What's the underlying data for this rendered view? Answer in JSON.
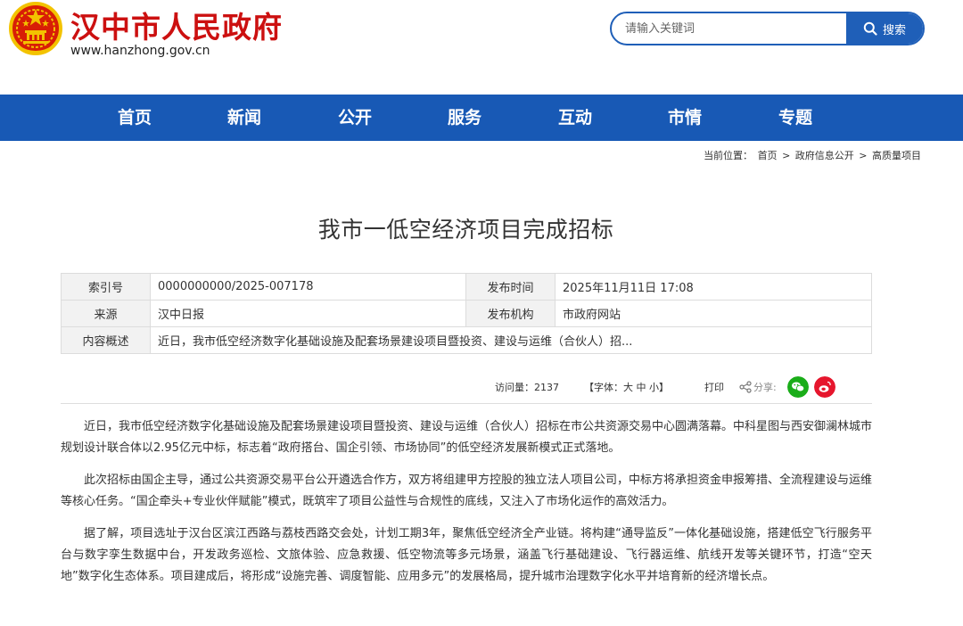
{
  "header": {
    "site_title": "汉中市人民政府",
    "site_url": "www.hanzhong.gov.cn",
    "emblem_icon": "national-emblem-icon"
  },
  "search": {
    "placeholder": "请输入关键词",
    "button_label": "搜索",
    "icon": "search-icon"
  },
  "nav": {
    "items": [
      {
        "label": "首页"
      },
      {
        "label": "新闻"
      },
      {
        "label": "公开"
      },
      {
        "label": "服务"
      },
      {
        "label": "互动"
      },
      {
        "label": "市情"
      },
      {
        "label": "专题"
      }
    ]
  },
  "breadcrumb": {
    "prefix": "当前位置：",
    "items": [
      "首页",
      "政府信息公开",
      "高质量项目"
    ],
    "separator": ">"
  },
  "article": {
    "title": "我市一低空经济项目完成招标",
    "meta": {
      "index_label": "索引号",
      "index_value": "0000000000/2025-007178",
      "publish_time_label": "发布时间",
      "publish_time_value": "2025年11月11日 17:08",
      "source_label": "来源",
      "source_value": "汉中日报",
      "publisher_label": "发布机构",
      "publisher_value": "市政府网站",
      "summary_label": "内容概述",
      "summary_value": "近日，我市低空经济数字化基础设施及配套场景建设项目暨投资、建设与运维（合伙人）招..."
    },
    "tools": {
      "views_label": "访问量：",
      "views_value": "2137",
      "font_prefix": "【字体：",
      "font_large": "大",
      "font_medium": "中",
      "font_small": "小",
      "font_suffix": "】",
      "print_label": "打印",
      "share_label": "分享:",
      "share_icon": "share-icon",
      "wechat_icon": "wechat-icon",
      "weibo_icon": "weibo-icon"
    },
    "paragraphs": [
      "近日，我市低空经济数字化基础设施及配套场景建设项目暨投资、建设与运维（合伙人）招标在市公共资源交易中心圆满落幕。中科星图与西安御澜林城市规划设计联合体以2.95亿元中标，标志着“政府搭台、国企引领、市场协同”的低空经济发展新模式正式落地。",
      "此次招标由国企主导，通过公共资源交易平台公开遴选合作方，双方将组建甲方控股的独立法人项目公司，中标方将承担资金申报筹措、全流程建设与运维等核心任务。“国企牵头+专业伙伴赋能”模式，既筑牢了项目公益性与合规性的底线，又注入了市场化运作的高效活力。",
      "据了解，项目选址于汉台区滨江西路与荔枝西路交会处，计划工期3年，聚焦低空经济全产业链。将构建“通导监反”一体化基础设施，搭建低空飞行服务平台与数字孪生数据中台，开发政务巡检、文旅体验、应急救援、低空物流等多元场景，涵盖飞行基础建设、飞行器运维、航线开发等关键环节，打造“空天地”数字化生态体系。项目建成后，将形成“设施完善、调度智能、应用多元”的发展格局，提升城市治理数字化水平并培育新的经济增长点。"
    ]
  },
  "colors": {
    "brand_red": "#cc1010",
    "nav_blue": "#1859b5",
    "search_blue": "#1f5fb8",
    "wechat_green": "#1aad19",
    "weibo_red": "#e6162d"
  }
}
